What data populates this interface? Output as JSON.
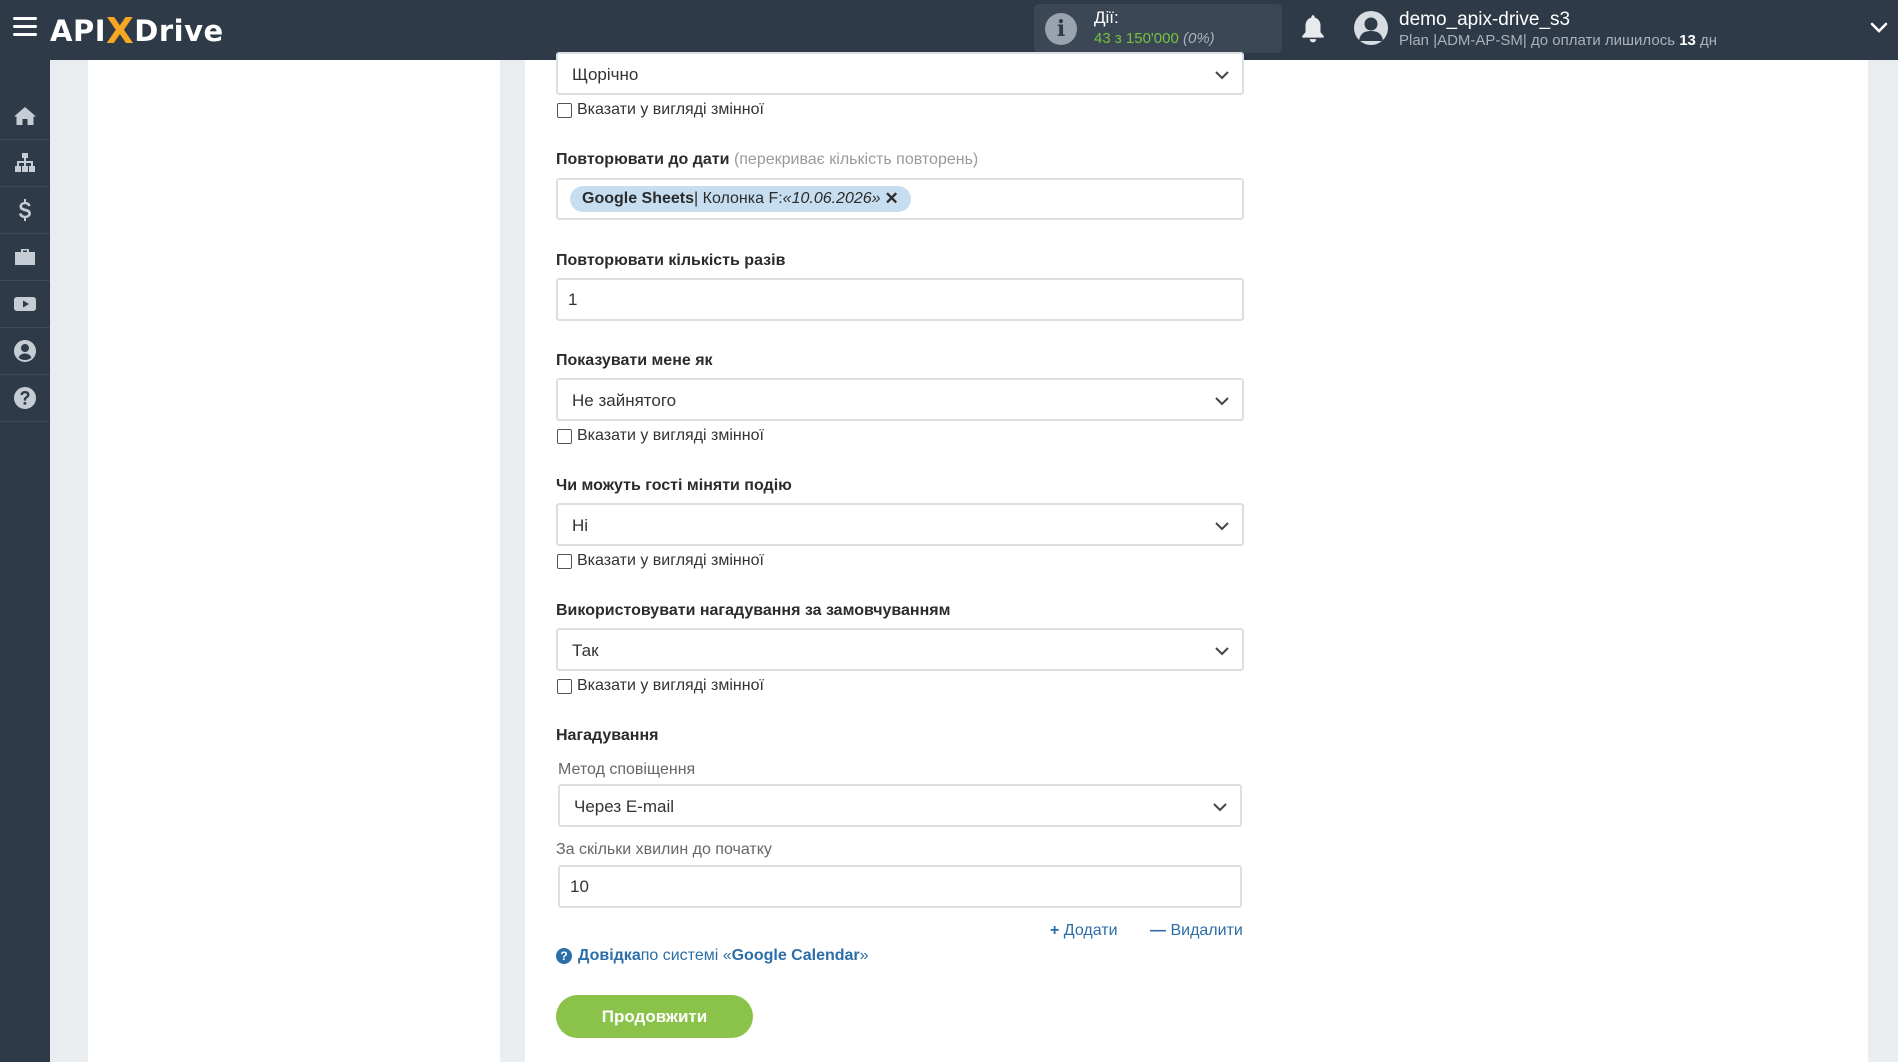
{
  "header": {
    "logo_pre": "API",
    "logo_x": "X",
    "logo_post": "Drive",
    "actions_label": "Дії:",
    "actions_count": "43 з 150'000",
    "actions_percent": "(0%)",
    "user_name": "demo_apix-drive_s3",
    "plan_text": "Plan |ADM-AP-SM| до оплати лишилось ",
    "plan_days": "13",
    "plan_days_unit": " дн"
  },
  "sidebar": {
    "items": [
      {
        "icon": "home-icon"
      },
      {
        "icon": "sitemap-icon"
      },
      {
        "icon": "dollar-icon"
      },
      {
        "icon": "briefcase-icon"
      },
      {
        "icon": "youtube-icon"
      },
      {
        "icon": "user-icon"
      },
      {
        "icon": "help-icon"
      }
    ]
  },
  "form": {
    "frequency_value": "Щорічно",
    "as_variable_label": "Вказати у вигляді змінної",
    "repeat_until_label": "Повторювати до дати",
    "repeat_until_hint": "(перекриває кількість повторень)",
    "repeat_until_tag_source": "Google Sheets",
    "repeat_until_tag_column": " | Колонка F: ",
    "repeat_until_tag_value": "«10.06.2026»",
    "repeat_count_label": "Повторювати кількість разів",
    "repeat_count_value": "1",
    "show_me_as_label": "Показувати мене як",
    "show_me_as_value": "Не зайнятого",
    "guests_modify_label": "Чи можуть гості міняти подію",
    "guests_modify_value": "Ні",
    "default_reminders_label": "Використовувати нагадування за замовчуванням",
    "default_reminders_value": "Так",
    "reminders_label": "Нагадування",
    "notify_method_label": "Метод сповіщення",
    "notify_method_value": "Через E-mail",
    "minutes_before_label": "За скільки хвилин до початку",
    "minutes_before_value": "10",
    "add_label": "Додати",
    "remove_label": "Видалити",
    "help_strong": "Довідка",
    "help_mid": " по системі «",
    "help_system": "Google Calendar",
    "help_end": "»",
    "continue_label": "Продовжити"
  },
  "colors": {
    "topbar": "#2e3a47",
    "accent_green": "#8bc34a",
    "link_blue": "#2b6ea8",
    "tag_bg": "#c7def0",
    "logo_orange": "#f5a623"
  }
}
